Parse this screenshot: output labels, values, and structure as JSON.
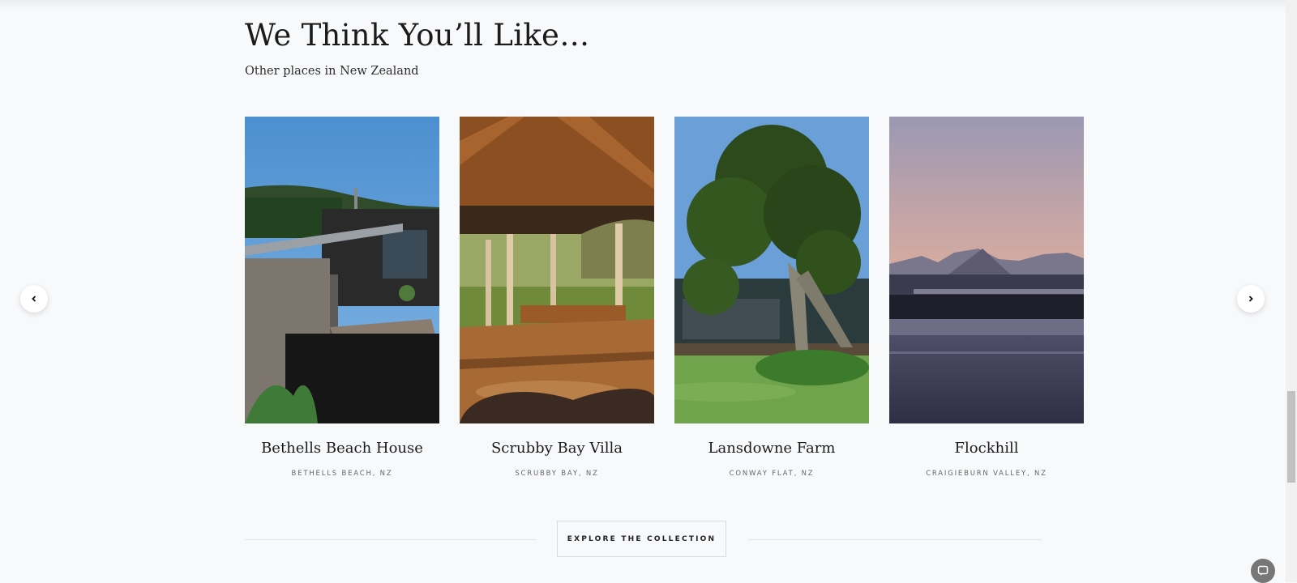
{
  "section": {
    "title": "We Think You’ll Like…",
    "subtitle": "Other places in New Zealand"
  },
  "cards": [
    {
      "name": "Bethells Beach House",
      "location": "BETHELLS BEACH, NZ"
    },
    {
      "name": "Scrubby Bay Villa",
      "location": "SCRUBBY BAY, NZ"
    },
    {
      "name": "Lansdowne Farm",
      "location": "CONWAY FLAT, NZ"
    },
    {
      "name": "Flockhill",
      "location": "CRAIGIEBURN VALLEY, NZ"
    }
  ],
  "cta": {
    "label": "EXPLORE THE COLLECTION"
  },
  "icons": {
    "prev": "chevron-left-icon",
    "next": "chevron-right-icon",
    "chat": "chat-icon"
  }
}
